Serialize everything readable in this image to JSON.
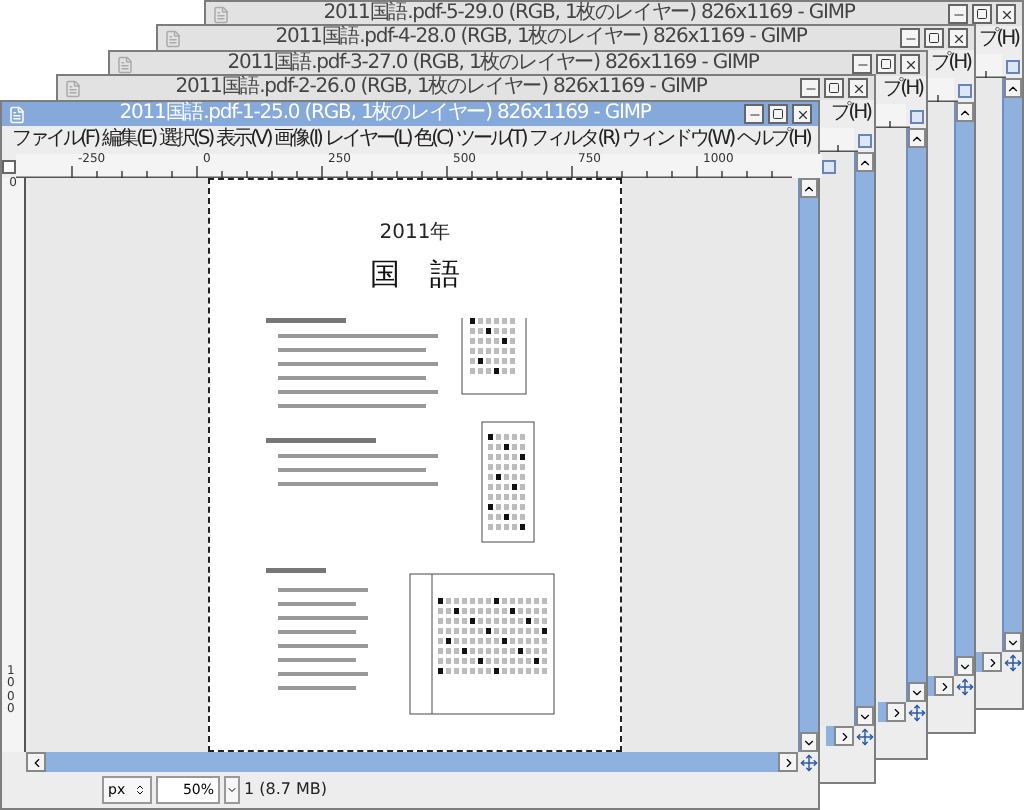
{
  "windows": [
    {
      "kind": "back",
      "title": "2011国語.pdf-5-29.0 (RGB, 1枚のレイヤー) 826x1169 - GIMP",
      "active": false,
      "menu": [
        {
          "label": "プ(H)"
        }
      ]
    },
    {
      "kind": "back",
      "title": "2011国語.pdf-4-28.0 (RGB, 1枚のレイヤー) 826x1169 - GIMP",
      "active": false,
      "menu": [
        {
          "label": "プ(H)"
        }
      ]
    },
    {
      "kind": "back",
      "title": "2011国語.pdf-3-27.0 (RGB, 1枚のレイヤー) 826x1169 - GIMP",
      "active": false,
      "menu": [
        {
          "label": "プ(H)"
        }
      ]
    },
    {
      "kind": "back",
      "title": "2011国語.pdf-2-26.0 (RGB, 1枚のレイヤー) 826x1169 - GIMP",
      "active": false,
      "menu": [
        {
          "label": "プ(H)"
        }
      ]
    },
    {
      "kind": "front",
      "title": "2011国語.pdf-1-25.0 (RGB, 1枚のレイヤー) 826x1169 - GIMP",
      "active": true,
      "menu": [
        {
          "label": "ファイル(F)"
        },
        {
          "label": "編集(E)"
        },
        {
          "label": "選択(S)"
        },
        {
          "label": "表示(V)"
        },
        {
          "label": "画像(I)"
        },
        {
          "label": "レイヤー(L)"
        },
        {
          "label": "色(C)"
        },
        {
          "label": "ツール(T)"
        },
        {
          "label": "フィルタ(R)"
        },
        {
          "label": "ウィンドウ(W)"
        },
        {
          "label": "ヘルプ(H)"
        }
      ],
      "ruler_labels": [
        "-250",
        "0",
        "250",
        "500",
        "750",
        "1000"
      ],
      "vruler_labels": [
        "0",
        "1000"
      ],
      "page": {
        "year": "2011年",
        "subject": "国　語"
      },
      "status": {
        "unit": "px",
        "zoom": "50%",
        "info": "1 (8.7 MB)"
      }
    }
  ]
}
